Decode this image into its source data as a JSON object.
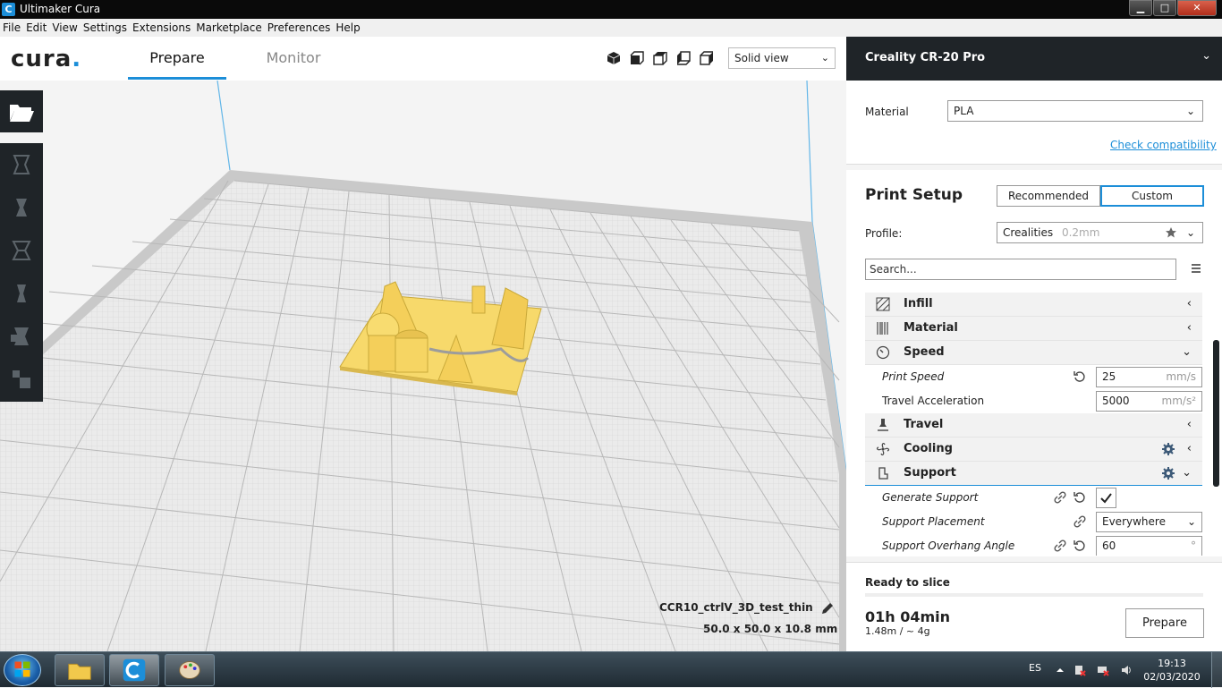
{
  "window": {
    "title": "Ultimaker Cura",
    "app_icon": "C",
    "controls": {
      "minimize": "▁",
      "maximize": "□",
      "close": "✕"
    }
  },
  "menubar": [
    "File",
    "Edit",
    "View",
    "Settings",
    "Extensions",
    "Marketplace",
    "Preferences",
    "Help"
  ],
  "stages": {
    "logo": "cura",
    "prepare": "Prepare",
    "monitor": "Monitor"
  },
  "view": {
    "mode": "Solid view",
    "icons": [
      "3d-view-icon",
      "front-view-icon",
      "top-view-icon",
      "left-view-icon",
      "right-view-icon"
    ]
  },
  "object": {
    "name": "CCR10_ctrlV_3D_test_thin",
    "dimensions": "50.0 x 50.0 x 10.8 mm"
  },
  "printer": {
    "name": "Creality CR-20 Pro"
  },
  "material": {
    "label": "Material",
    "value": "PLA",
    "check_compat": "Check compatibility"
  },
  "print_setup": {
    "title": "Print Setup",
    "recommended": "Recommended",
    "custom": "Custom",
    "profile_label": "Profile:",
    "profile_value": "Crealities",
    "profile_hint": "0.2mm",
    "search_placeholder": "Search..."
  },
  "settings": {
    "infill": "Infill",
    "material": "Material",
    "speed": "Speed",
    "print_speed": {
      "label": "Print Speed",
      "value": "25",
      "unit": "mm/s"
    },
    "travel_accel": {
      "label": "Travel Acceleration",
      "value": "5000",
      "unit": "mm/s²"
    },
    "travel": "Travel",
    "cooling": "Cooling",
    "support": "Support",
    "generate_support": {
      "label": "Generate Support",
      "checked": true
    },
    "support_placement": {
      "label": "Support Placement",
      "value": "Everywhere"
    },
    "overhang_angle": {
      "label": "Support Overhang Angle",
      "value": "60",
      "unit": "°"
    }
  },
  "slice": {
    "status": "Ready to slice",
    "time": "01h 04min",
    "usage": "1.48m / ~ 4g",
    "button": "Prepare"
  },
  "taskbar": {
    "lang": "ES",
    "time": "19:13",
    "date": "02/03/2020"
  },
  "colors": {
    "accent": "#1c8ed8",
    "panel_dark": "#1f2428",
    "model": "#f7d96b"
  }
}
